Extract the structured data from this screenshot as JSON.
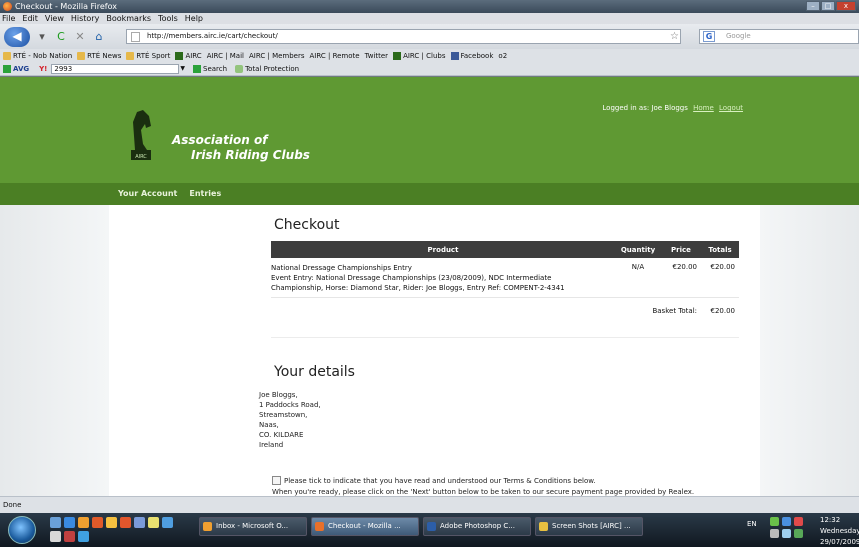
{
  "window": {
    "title": "Checkout - Mozilla Firefox",
    "buttons": [
      "–",
      "□",
      "x"
    ]
  },
  "menu": [
    "File",
    "Edit",
    "View",
    "History",
    "Bookmarks",
    "Tools",
    "Help"
  ],
  "nav": {
    "url": "http://members.airc.ie/cart/checkout/",
    "search_placeholder": "Google",
    "search_engine_icon": "G",
    "star_icon": "☆"
  },
  "bookmarks": [
    {
      "label": "RTÉ - Nob Nation",
      "icon": "folder"
    },
    {
      "label": "RTÉ News",
      "icon": "folder"
    },
    {
      "label": "RTÉ Sport",
      "icon": "folder"
    },
    {
      "label": "AIRC",
      "icon": "horse"
    },
    {
      "label": "AIRC | Mail",
      "icon": "page"
    },
    {
      "label": "AIRC | Members",
      "icon": "page"
    },
    {
      "label": "AIRC | Remote",
      "icon": "page"
    },
    {
      "label": "Twitter",
      "icon": "page"
    },
    {
      "label": "AIRC | Clubs",
      "icon": "horse"
    },
    {
      "label": "Facebook",
      "icon": "fb"
    },
    {
      "label": "o2",
      "icon": "page"
    }
  ],
  "toolbar": {
    "avg_label": "AVG",
    "yahoo_label": "Y!",
    "input_value": "2993",
    "search_label": "Search",
    "protection_label": "Total Protection"
  },
  "site": {
    "logged_in_text": "Logged in as: Joe Bloggs",
    "home_link": "Home",
    "logout_link": "Logout",
    "logo_line1": "Association of",
    "logo_line2": "Irish Riding Clubs",
    "logo_small": "AIRC",
    "nav": [
      "Your Account",
      "Entries"
    ]
  },
  "checkout": {
    "heading": "Checkout",
    "columns": [
      "Product",
      "Quantity",
      "Price",
      "Totals"
    ],
    "item": {
      "line1": "National Dressage Championships Entry",
      "line2": "Event Entry: National Dressage Championships (23/08/2009), NDC Intermediate",
      "line3": "Championship, Horse: Diamond Star, Rider: Joe Bloggs, Entry Ref: COMPENT-2-4341",
      "quantity": "N/A",
      "price": "€20.00",
      "total": "€20.00"
    },
    "basket_total_label": "Basket Total:",
    "basket_total_value": "€20.00"
  },
  "details": {
    "heading": "Your details",
    "address": [
      "Joe Bloggs,",
      "1 Paddocks Road,",
      "Streamstown,",
      "Naas,",
      "CO. KILDARE",
      "Ireland"
    ],
    "terms_text": "Please tick to indicate that you have read and understood our Terms & Conditions below.",
    "next_text": "When you're ready, please click on the 'Next' button below to be taken to our secure payment page provided by Realex."
  },
  "status": "Done",
  "taskbar": {
    "tasks": [
      {
        "label": "Inbox - Microsoft O...",
        "color": "#f0a030"
      },
      {
        "label": "Checkout - Mozilla ...",
        "color": "#e8702a"
      },
      {
        "label": "Adobe Photoshop C...",
        "color": "#2c5ea8"
      },
      {
        "label": "Screen Shots [AIRC] ...",
        "color": "#e8c040"
      }
    ],
    "lang": "EN",
    "time": "12:32",
    "day": "Wednesday",
    "date": "29/07/2009"
  }
}
